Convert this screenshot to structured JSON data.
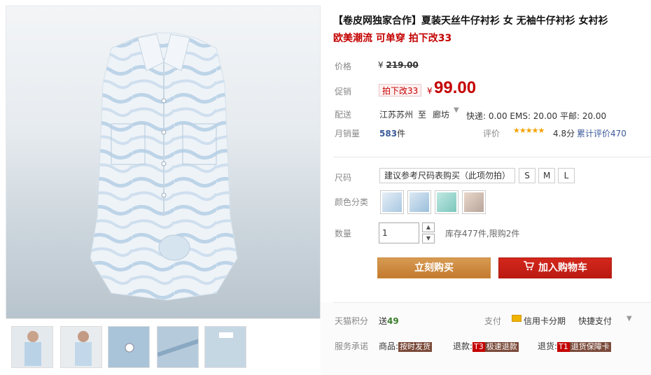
{
  "product": {
    "title": "【卷皮网独家合作】夏装天丝牛仔衬衫 女 无袖牛仔衬衫 女衬衫",
    "subtitle": "欧美潮流 可单穿 拍下改33"
  },
  "price": {
    "label": "价格",
    "currency": "¥",
    "original": "219.00"
  },
  "promo": {
    "label": "促销",
    "tag": "拍下改33",
    "currency": "¥",
    "price": "99.00"
  },
  "shipping": {
    "label": "配送",
    "from": "江苏苏州",
    "to_word": "至",
    "to": "廊坊",
    "fees": "快递: 0.00 EMS: 20.00 平邮: 20.00"
  },
  "sales": {
    "label": "月销量",
    "count": "583",
    "unit": "件",
    "rating_label": "评价",
    "stars": "★★★★★",
    "score": "4.8分",
    "reviews": "累计评价470"
  },
  "size": {
    "label": "尺码",
    "options": [
      "建议参考尺码表购买（此项勿拍）",
      "S",
      "M",
      "L"
    ]
  },
  "color": {
    "label": "颜色分类",
    "swatches": [
      "#c9dcec",
      "#b9d2e6",
      "#8fd0c8",
      "#d2b9a8"
    ]
  },
  "quantity": {
    "label": "数量",
    "value": "1",
    "up": "▲",
    "down": "▼",
    "stock": "库存477件,限购2件"
  },
  "actions": {
    "buy": "立刻购买",
    "cart": "加入购物车"
  },
  "points": {
    "label": "天猫积分",
    "text": "送",
    "value": "49"
  },
  "payment": {
    "label": "支付",
    "credit": "信用卡分期",
    "quick": "快捷支付",
    "caret": "▼"
  },
  "services": {
    "label": "服务承诺",
    "goods_label": "商品:",
    "goods_tag": "按时发货",
    "refund_label": "退款:",
    "refund_code": "T3",
    "refund_tag": "极速退款",
    "return_label": "退货:",
    "return_code": "T1",
    "return_tag": "退货保障卡"
  },
  "colors": {
    "accent_red": "#c40000",
    "buy_orange": "#c37a2e",
    "cart_red": "#bb1a12",
    "link_blue": "#3c5a99"
  }
}
